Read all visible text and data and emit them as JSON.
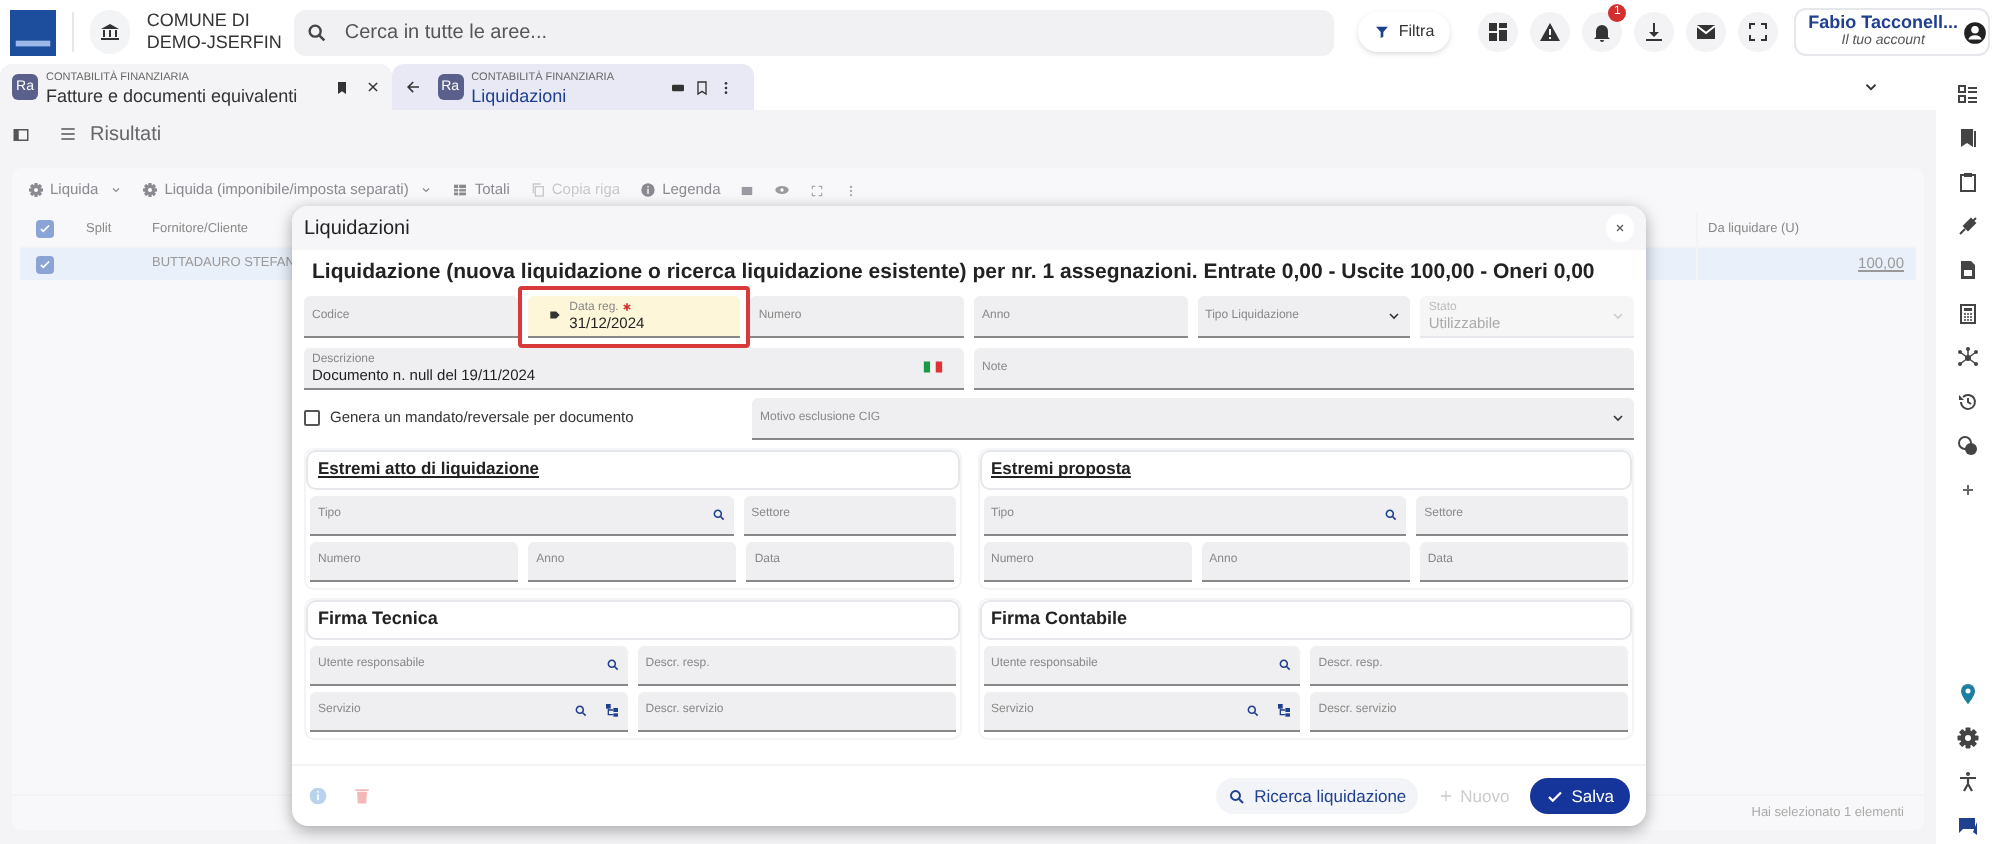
{
  "header": {
    "org_name": [
      "COMUNE DI",
      "DEMO-JSERFIN"
    ],
    "search": {
      "placeholder": "Cerca in tutte le aree..."
    },
    "filter_button": "Filtra",
    "notification_count": "1",
    "user": {
      "name": "Fabio Tacconell...",
      "subtitle": "Il tuo account"
    }
  },
  "tabs": [
    {
      "badge": "Ra",
      "category": "CONTABILITÀ FINANZIARIA",
      "title": "Fatture e documenti equivalenti",
      "selected": false
    },
    {
      "badge": "Ra",
      "category": "CONTABILITÀ FINANZIARIA",
      "title": "Liquidazioni",
      "selected": true
    }
  ],
  "results_title": "Risultati",
  "toolbar": [
    {
      "kind": "action_menu",
      "label": "Liquida",
      "disabled": false
    },
    {
      "kind": "action_menu",
      "label": "Liquida (imponibile/imposta separati)",
      "disabled": false
    },
    {
      "kind": "totals",
      "label": "Totali",
      "disabled": false
    },
    {
      "kind": "copy",
      "label": "Copia riga",
      "disabled": true
    },
    {
      "kind": "legend",
      "label": "Legenda",
      "disabled": false
    }
  ],
  "table": {
    "select_all_checked": true,
    "columns": [
      "Split",
      "Fornitore/Cliente",
      "Da liquidare (U)"
    ],
    "rows": [
      {
        "checked": true,
        "selected": true,
        "fornitore_cliente": "BUTTADAURO STEFAN",
        "da_liquidare": "100,00"
      }
    ],
    "footer": "Hai selezionato 1 elementi"
  },
  "modal": {
    "title": "Liquidazioni",
    "heading": "Liquidazione (nuova liquidazione o ricerca liquidazione esistente) per nr. 1 assegnazioni. Entrate 0,00 - Uscite 100,00 - Oneri 0,00",
    "lines": [
      {
        "fields": [
          {
            "kind": "text",
            "label": "Codice"
          },
          {
            "kind": "date",
            "label": "Data reg.",
            "value": "31/12/2024",
            "required": true,
            "highlighted": true
          },
          {
            "kind": "text",
            "label": "Numero"
          },
          {
            "kind": "text",
            "label": "Anno"
          },
          {
            "kind": "select",
            "label": "Tipo Liquidazione"
          },
          {
            "kind": "select",
            "label": "Stato",
            "value": "Utilizzabile",
            "disabled": true
          }
        ]
      },
      {
        "fields": [
          {
            "kind": "translatable",
            "label": "Descrizione",
            "value": "Documento n. null del 19/11/2024"
          },
          {
            "kind": "text",
            "label": "Note"
          }
        ]
      },
      {
        "fields": [
          {
            "kind": "checkbox",
            "label": "Genera un mandato/reversale per documento",
            "checked": false
          },
          {
            "kind": "select",
            "label": "Motivo esclusione CIG"
          }
        ]
      }
    ],
    "sections": [
      {
        "kind": "estremi",
        "title": "Estremi atto di liquidazione",
        "lines": [
          {
            "fields": [
              {
                "kind": "search",
                "label": "Tipo"
              },
              {
                "kind": "text",
                "label": "Settore"
              }
            ]
          },
          {
            "fields": [
              {
                "kind": "text",
                "label": "Numero"
              },
              {
                "kind": "text",
                "label": "Anno"
              },
              {
                "kind": "text",
                "label": "Data"
              }
            ]
          }
        ]
      },
      {
        "kind": "estremi",
        "title": "Estremi proposta",
        "lines": [
          {
            "fields": [
              {
                "kind": "search",
                "label": "Tipo"
              },
              {
                "kind": "text",
                "label": "Settore"
              }
            ]
          },
          {
            "fields": [
              {
                "kind": "text",
                "label": "Numero"
              },
              {
                "kind": "text",
                "label": "Anno"
              },
              {
                "kind": "text",
                "label": "Data"
              }
            ]
          }
        ]
      },
      {
        "kind": "firma",
        "title": "Firma Tecnica",
        "lines": [
          {
            "fields": [
              {
                "kind": "search",
                "label": "Utente responsabile"
              },
              {
                "kind": "text",
                "label": "Descr. resp."
              }
            ]
          },
          {
            "fields": [
              {
                "kind": "tree",
                "label": "Servizio"
              },
              {
                "kind": "text",
                "label": "Descr. servizio"
              }
            ]
          }
        ]
      },
      {
        "kind": "firma",
        "title": "Firma Contabile",
        "lines": [
          {
            "fields": [
              {
                "kind": "search",
                "label": "Utente responsabile"
              },
              {
                "kind": "text",
                "label": "Descr. resp."
              }
            ]
          },
          {
            "fields": [
              {
                "kind": "tree",
                "label": "Servizio"
              },
              {
                "kind": "text",
                "label": "Descr. servizio"
              }
            ]
          }
        ]
      }
    ],
    "buttons": [
      {
        "kind": "search",
        "label": "Ricerca liquidazione",
        "disabled": false
      },
      {
        "kind": "new",
        "label": "Nuovo",
        "disabled": true
      },
      {
        "kind": "save",
        "label": "Salva",
        "disabled": false
      }
    ]
  }
}
